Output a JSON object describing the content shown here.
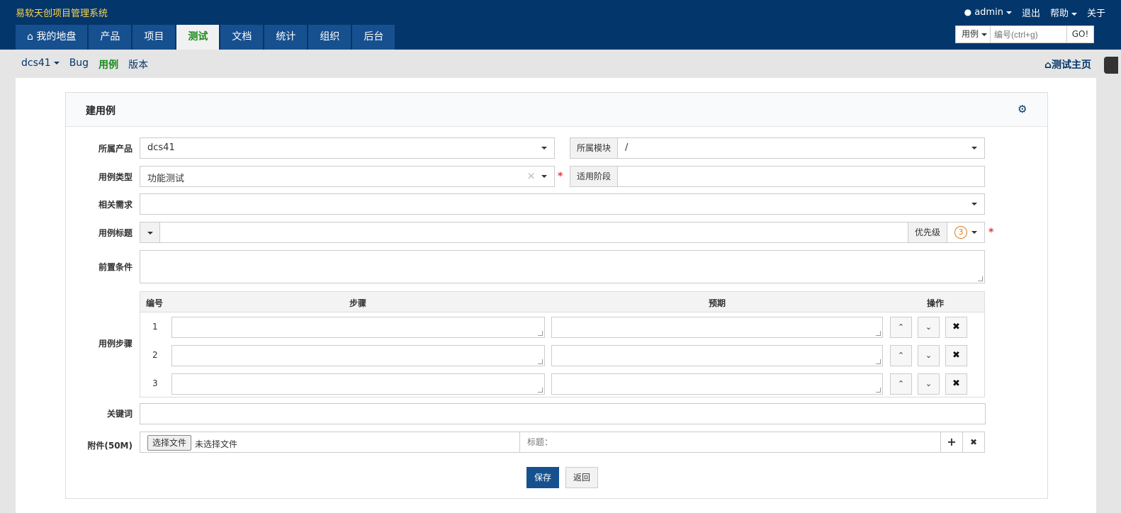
{
  "header": {
    "brand": "易软天创项目管理系统",
    "user": "admin",
    "links": [
      "退出",
      "帮助",
      "关于"
    ],
    "nav": [
      {
        "label": "我的地盘",
        "active": false
      },
      {
        "label": "产品",
        "active": false
      },
      {
        "label": "项目",
        "active": false
      },
      {
        "label": "测试",
        "active": true
      },
      {
        "label": "文档",
        "active": false
      },
      {
        "label": "统计",
        "active": false
      },
      {
        "label": "组织",
        "active": false
      },
      {
        "label": "后台",
        "active": false
      }
    ],
    "search": {
      "type": "用例",
      "placeholder": "编号(ctrl+g)",
      "go": "GO!"
    }
  },
  "subnav": {
    "product": "dcs41",
    "items": [
      {
        "label": "Bug",
        "active": false
      },
      {
        "label": "用例",
        "active": true
      },
      {
        "label": "版本",
        "active": false
      }
    ],
    "home": "测试主页"
  },
  "form": {
    "title": "建用例",
    "product": {
      "label": "所属产品",
      "value": "dcs41"
    },
    "module": {
      "label": "所属模块",
      "value": "/"
    },
    "type": {
      "label": "用例类型",
      "value": "功能测试"
    },
    "stage": {
      "label": "适用阶段",
      "value": ""
    },
    "story": {
      "label": "相关需求",
      "value": ""
    },
    "case_title": {
      "label": "用例标题",
      "value": "",
      "priority_label": "优先级",
      "priority": "3"
    },
    "precondition": {
      "label": "前置条件",
      "value": ""
    },
    "steps": {
      "label": "用例步骤",
      "headers": {
        "no": "编号",
        "step": "步骤",
        "expect": "预期",
        "action": "操作"
      },
      "rows": [
        {
          "no": "1",
          "step": "",
          "expect": ""
        },
        {
          "no": "2",
          "step": "",
          "expect": ""
        },
        {
          "no": "3",
          "step": "",
          "expect": ""
        }
      ]
    },
    "keywords": {
      "label": "关键词",
      "value": ""
    },
    "files": {
      "label": "附件(50M)",
      "choose": "选择文件",
      "none": "未选择文件",
      "title_placeholder": "标题："
    },
    "save": "保存",
    "back": "返回"
  },
  "colors": {
    "header": "#03366b",
    "nav": "#17508f",
    "active_green": "#1a8a1a",
    "required": "#e53935",
    "brand": "#ffd54f"
  }
}
